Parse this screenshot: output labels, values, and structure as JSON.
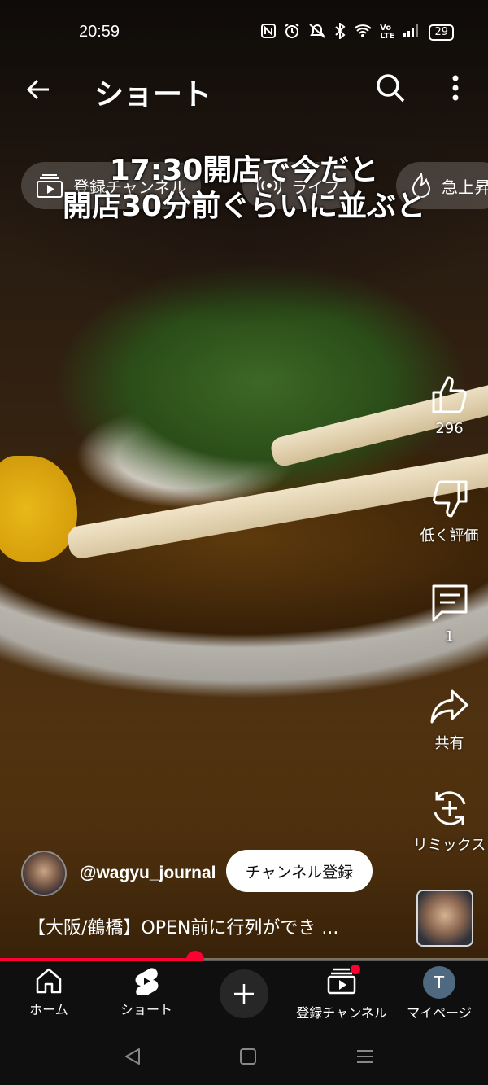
{
  "status_bar": {
    "time": "20:59",
    "battery": "29",
    "icons": [
      "nfc-icon",
      "alarm-icon",
      "mute-icon",
      "bluetooth-icon",
      "wifi-icon",
      "volte-icon",
      "signal-icon"
    ]
  },
  "topbar": {
    "title": "ショート"
  },
  "chips": [
    {
      "label": "登録チャンネル",
      "icon": "subscriptions-icon"
    },
    {
      "label": "ライブ",
      "icon": "live-icon"
    },
    {
      "label": "急上昇",
      "icon": "trending-icon"
    }
  ],
  "caption": {
    "line1": "17:30開店で今だと",
    "line2": "開店30分前ぐらいに並ぶと"
  },
  "rail": {
    "like_count": "296",
    "dislike_label": "低く評価",
    "comment_count": "1",
    "share_label": "共有",
    "remix_label": "リミックス"
  },
  "channel": {
    "handle": "@wagyu_journal",
    "subscribe_label": "チャンネル登録"
  },
  "video": {
    "title": "【大阪/鶴橋】OPEN前に行列ができ ...",
    "progress_fraction": 0.4
  },
  "bottom_nav": {
    "items": [
      {
        "label": "ホーム",
        "icon": "home-icon"
      },
      {
        "label": "ショート",
        "icon": "shorts-icon"
      },
      {
        "label": "",
        "icon": "create-icon"
      },
      {
        "label": "登録チャンネル",
        "icon": "subscriptions-icon"
      },
      {
        "label": "マイページ",
        "icon": "avatar"
      }
    ],
    "avatar_initial": "T"
  },
  "colors": {
    "accent": "#ff0033",
    "nav_bg": "#0f0f0f"
  }
}
